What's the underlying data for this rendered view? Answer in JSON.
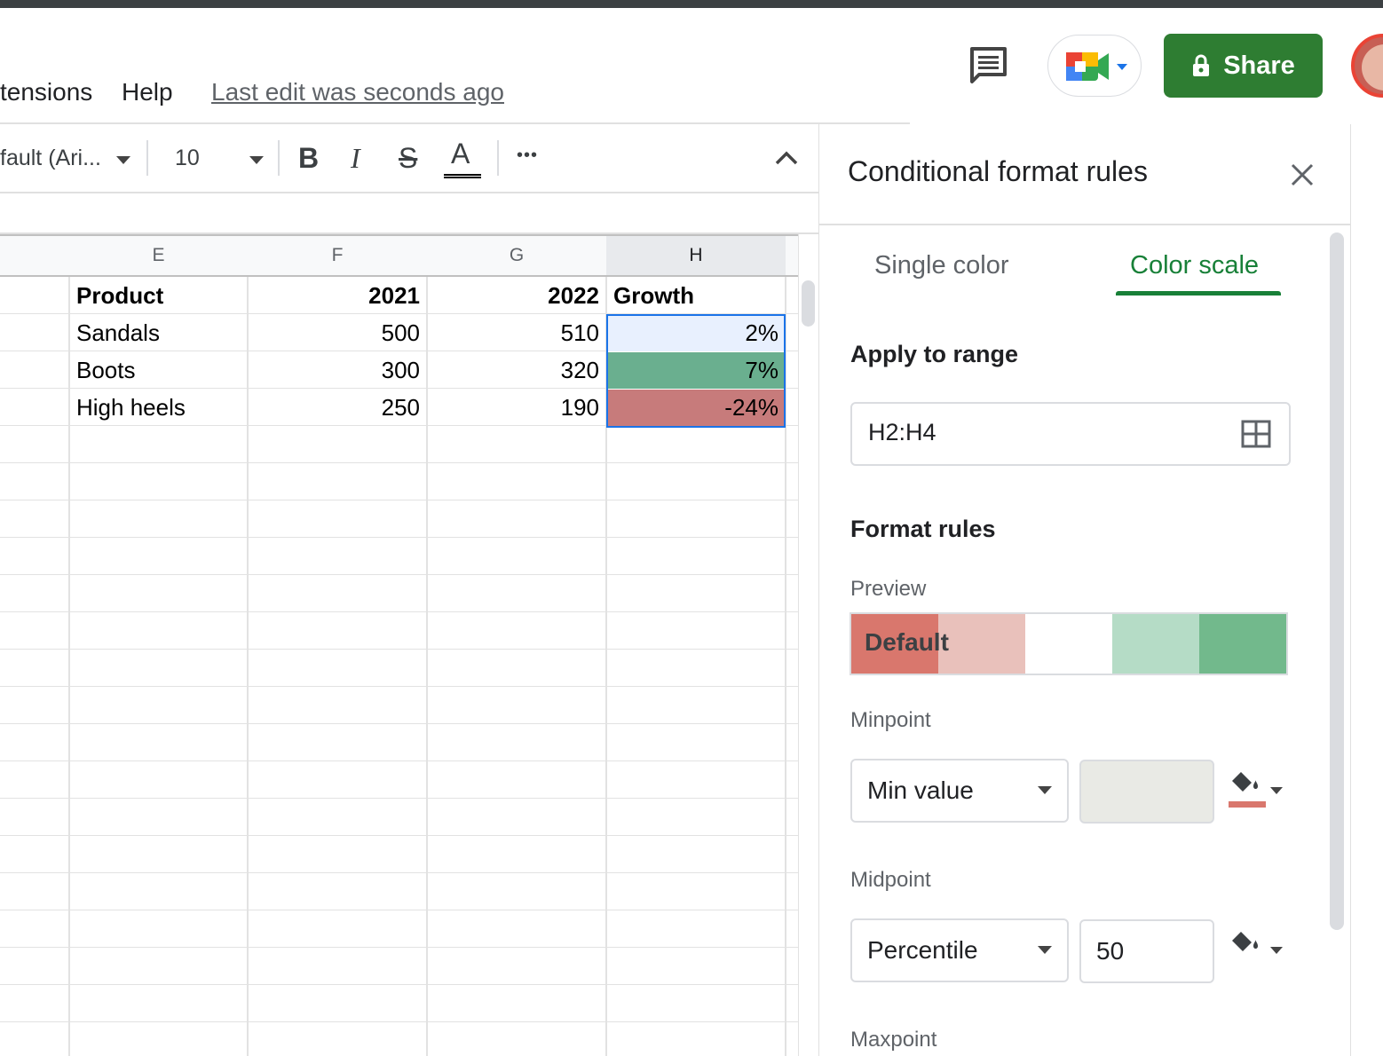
{
  "menu": {
    "extensions": "tensions",
    "help": "Help"
  },
  "last_edit": "Last edit was seconds ago",
  "share": {
    "label": "Share"
  },
  "toolbar": {
    "font": "fault (Ari...",
    "font_size": "10",
    "bold": "B",
    "italic": "I",
    "strike": "S",
    "text_color": "A",
    "more": "•••"
  },
  "columns": [
    "E",
    "F",
    "G",
    "H"
  ],
  "rows": [
    [
      "Product",
      "2021",
      "2022",
      "Growth"
    ],
    [
      "Sandals",
      "500",
      "510",
      "2%"
    ],
    [
      "Boots",
      "300",
      "320",
      "7%"
    ],
    [
      "High heels",
      "250",
      "190",
      "-24%"
    ]
  ],
  "growth_cell_colors": [
    "#e8f0fe",
    "#6aaf8f",
    "#c77b7b"
  ],
  "panel": {
    "title": "Conditional format rules",
    "tabs": [
      "Single color",
      "Color scale"
    ],
    "active_tab": "Color scale",
    "apply_to_range_label": "Apply to range",
    "range_value": "H2:H4",
    "format_rules_label": "Format rules",
    "preview_label": "Preview",
    "preview_text": "Default",
    "preview_colors": [
      "#d9776d",
      "#e9c1bb",
      "#ffffff",
      "#b5dcc6",
      "#72b98c"
    ],
    "minpoint": {
      "label": "Minpoint",
      "type": "Min value",
      "value": "",
      "color": "#d9776d"
    },
    "midpoint": {
      "label": "Midpoint",
      "type": "Percentile",
      "value": "50"
    },
    "maxpoint_label": "Maxpoint"
  },
  "colors": {
    "accent_green": "#188038",
    "share_bg": "#2e7d32",
    "selection_blue": "#1a73e8"
  }
}
